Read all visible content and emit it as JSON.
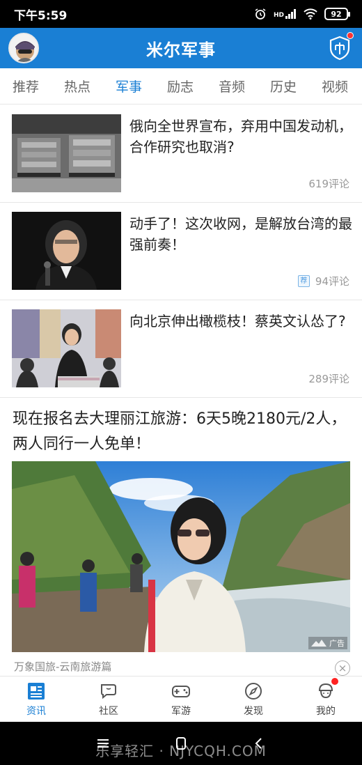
{
  "status_bar": {
    "time": "下午5:59",
    "network": "HD",
    "battery": "92"
  },
  "header": {
    "title": "米尔军事"
  },
  "tabs": [
    {
      "label": "推荐"
    },
    {
      "label": "热点"
    },
    {
      "label": "军事"
    },
    {
      "label": "励志"
    },
    {
      "label": "音频"
    },
    {
      "label": "历史"
    },
    {
      "label": "视频"
    }
  ],
  "active_tab": "军事",
  "news": [
    {
      "headline": "俄向全世界宣布，弃用中国发动机，合作研究也取消?",
      "comments": "619评论",
      "badge": ""
    },
    {
      "headline": "动手了！这次收网，是解放台湾的最强前奏！",
      "comments": "94评论",
      "badge": "荐"
    },
    {
      "headline": "向北京伸出橄榄枝！蔡英文认怂了?",
      "comments": "289评论",
      "badge": ""
    }
  ],
  "ad": {
    "title": "现在报名去大理丽江旅游：6天5晚2180元/2人，两人同行一人免单！",
    "tag": "广告",
    "source": "万象国旅-云南旅游篇",
    "close": "×"
  },
  "bottom_nav": [
    {
      "label": "资讯"
    },
    {
      "label": "社区"
    },
    {
      "label": "军游"
    },
    {
      "label": "发现"
    },
    {
      "label": "我的"
    }
  ],
  "watermark": "乐享轻汇 · NJYCQH.COM",
  "colors": {
    "primary": "#1a7fd4",
    "badge_red": "#ff2222"
  }
}
